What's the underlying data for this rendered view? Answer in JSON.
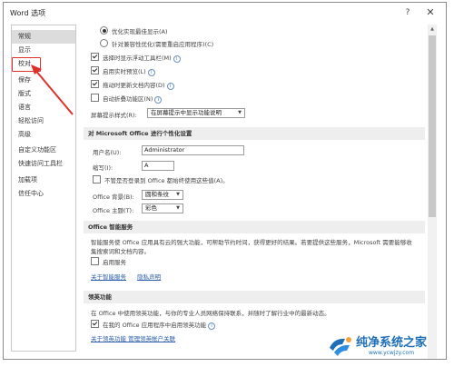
{
  "window": {
    "title": "Word 选项",
    "help": "?",
    "close": "✕"
  },
  "sidebar": {
    "items": [
      {
        "label": "常规"
      },
      {
        "label": "显示"
      },
      {
        "label": "校对"
      },
      {
        "label": "保存"
      },
      {
        "label": "版式"
      },
      {
        "label": "语言"
      },
      {
        "label": "轻松访问"
      },
      {
        "label": "高级"
      },
      {
        "label": "自定义功能区"
      },
      {
        "label": "快速访问工具栏"
      },
      {
        "label": "加载项"
      },
      {
        "label": "信任中心"
      }
    ]
  },
  "ui_options": {
    "radio1": "优化实现最佳显示(A)",
    "radio2": "针对兼容性优化(需要重启应用程序)(C)",
    "cb1": "选择时显示浮动工具栏(M)",
    "cb2": "启用实时预览(L)",
    "cb3": "拖动时更新文档内容(D)",
    "cb4": "自动折叠功能区(N)",
    "tooltip_label": "屏幕提示样式(R):",
    "tooltip_value": "在屏幕提示中显示功能说明"
  },
  "personalize": {
    "header": "对 Microsoft Office 进行个性化设置",
    "username_label": "用户名(U):",
    "username_value": "Administrator",
    "initials_label": "缩写(I):",
    "initials_value": "A",
    "always_use": "不管是否登录到 Office 都始终使用这些值(A)。",
    "background_label": "Office 背景(B):",
    "background_value": "圆和条纹",
    "theme_label": "Office 主题(T):",
    "theme_value": "彩色"
  },
  "smart": {
    "header": "Office 智能服务",
    "description": "智能服务使 Office 应用具有云的强大功能，可帮助节约时间，获得更好的结果。若要提供这些服务，Microsoft 需要能够收集搜索词和文档内容。",
    "enable": "启用服务",
    "link1": "关于智能服务",
    "link2": "隐私声明"
  },
  "linkedin": {
    "header": "领英功能",
    "description": "在 Office 中使用领英功能，与你的专业人员网络保持联系，并随时了解行业中的最新动态。",
    "enable": "在我的 Office 应用程序中启用领英功能",
    "links": "关于领英功能   管理领英帐户关联"
  },
  "watermark": {
    "brand": "纯净系统之家",
    "url": "www.ycwjzy.com"
  },
  "colors": {
    "highlight": "#e0302a",
    "link": "#2a5caa",
    "selected_nav": "#dcdcdc"
  }
}
